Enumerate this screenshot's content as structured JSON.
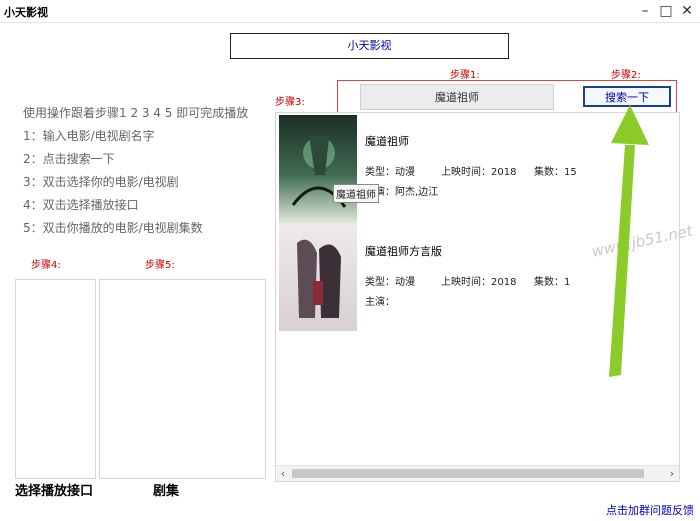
{
  "window": {
    "title": "小天影视",
    "minimize_glyph": "–",
    "maximize_glyph": "□",
    "close_glyph": "✕"
  },
  "banner": "小天影视",
  "instructions": [
    "使用操作跟着步骤1 2 3 4 5 即可完成播放",
    "1：输入电影/电视剧名字",
    "2：点击搜索一下",
    "3：双击选择你的电影/电视剧",
    "4：双击选择播放接口",
    "5：双击你播放的电影/电视剧集数"
  ],
  "steps": {
    "step1": "步骤1:",
    "step2": "步骤2:",
    "step3": "步骤3:",
    "step4": "步骤4:",
    "step5": "步骤5:"
  },
  "search": {
    "value": "魔道祖师",
    "button": "搜索一下"
  },
  "results": [
    {
      "title": "魔道祖师",
      "type": "类型：动漫",
      "date": "上映时间：2018",
      "episodes": "集数：15",
      "cast": "主演：阿杰,边江",
      "tooltip": "魔道祖师",
      "poster_colors": [
        "#1d3b2a",
        "#5a8a6a",
        "#d9e6d8"
      ]
    },
    {
      "title": "魔道祖师方言版",
      "type": "类型：动漫",
      "date": "上映时间：2018",
      "episodes": "集数：1",
      "cast": "主演：",
      "poster_colors": [
        "#e9e4e2",
        "#5a4a52",
        "#8a2a3a"
      ]
    }
  ],
  "bottom": {
    "interface_label": "选择播放接口",
    "episodes_label": "剧集",
    "feedback": "点击加群问题反馈"
  },
  "watermark": "www.jb51.net",
  "accent": {
    "red": "#cc0000",
    "blue": "#0000aa",
    "arrow_green": "#8ccc2a"
  }
}
